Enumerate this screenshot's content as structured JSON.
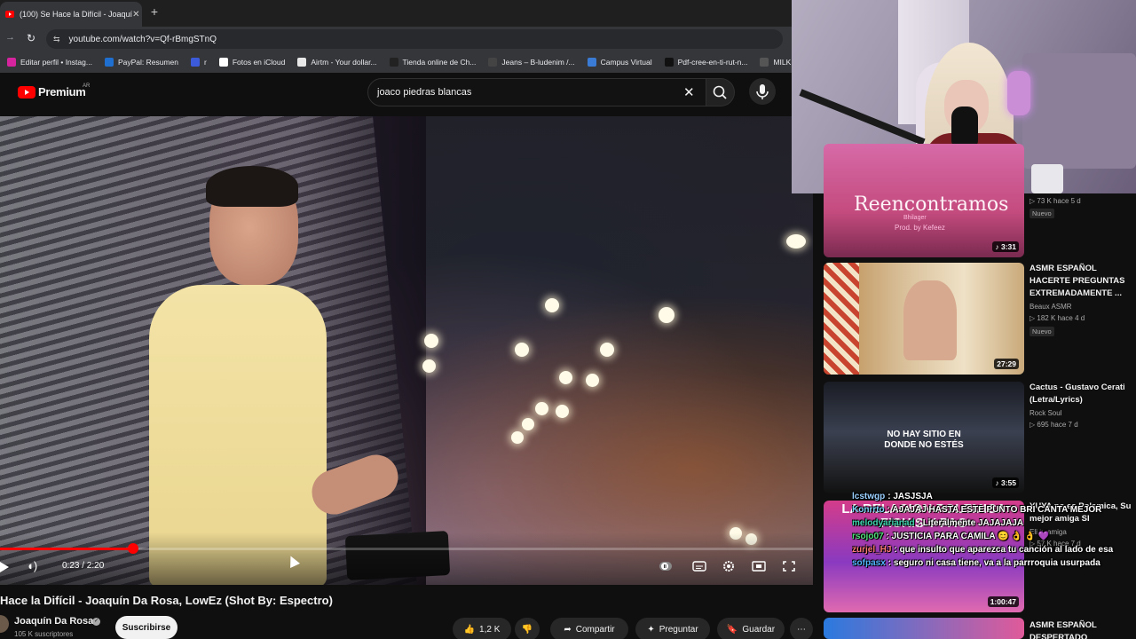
{
  "browser": {
    "tab_title": "(100) Se Hace la Difícil - Joaquí",
    "tab_close": "✕",
    "new_tab": "+",
    "back": "→",
    "reload": "↻",
    "site_info": "⇆",
    "url": "youtube.com/watch?v=Qf-rBmgSTnQ",
    "bookmarks": [
      {
        "label": "Editar perfil • Instag...",
        "color": "#d6249f"
      },
      {
        "label": "PayPal: Resumen",
        "color": "#1f6fd0"
      },
      {
        "label": "r",
        "color": "#3b5bdb"
      },
      {
        "label": "Fotos en iCloud",
        "color": "#ffffff"
      },
      {
        "label": "Airtm - Your dollar...",
        "color": "#e8e8e8"
      },
      {
        "label": "Tienda online de Ch...",
        "color": "#222222"
      },
      {
        "label": "Jeans – B-ludenim /...",
        "color": "#444444"
      },
      {
        "label": "Campus Virtual",
        "color": "#3a7bd5"
      },
      {
        "label": "Pdf-cree-en-ti-rut-n...",
        "color": "#111111"
      },
      {
        "label": "MILK | Sitio",
        "color": "#555555"
      }
    ]
  },
  "youtube": {
    "logo_text": "Premium",
    "logo_region": "AR",
    "search_query": "joaco piedras blancas",
    "search_clear": "✕",
    "video": {
      "progress_fraction": 0.164,
      "time": "0:23 / 2:20",
      "title": "Hace la Difícil - Joaquín Da Rosa, LowEz (Shot By: Espectro)",
      "channel": "Joaquín Da Rosa",
      "verified": "✓",
      "subscribers": "105 K suscriptores",
      "subscribe_label": "Suscribirse",
      "likes": "1,2 K",
      "share_label": "Compartir",
      "ask_label": "Preguntar",
      "save_label": "Guardar",
      "more": "⋯"
    },
    "sidebar": [
      {
        "title": "",
        "meta1": "▷ 73 K  hace 5 d",
        "badge": "Nuevo",
        "duration": "♪ 3:31",
        "thumb_text": "Reencontramos",
        "thumb_sub": "Prod. by Kefeez",
        "thumb_credit": "Bhilager"
      },
      {
        "title": "ASMR ESPAÑOL HACERTE PREGUNTAS EXTREMADAMENTE ...",
        "meta1": "Beaux ASMR",
        "meta2": "▷ 182 K  hace 4 d",
        "badge": "Nuevo",
        "duration": "27:29"
      },
      {
        "title": "Cactus - Gustavo Cerati (Letra/Lyrics)",
        "meta1": "Rock Soul",
        "meta2": "▷ 695  hace 7 d",
        "duration": "♪ 3:55",
        "thumb_text": "NO HAY SITIO EN DONDE NO ESTÉS"
      },
      {
        "title": "YUYA no es Polemica, Su mejor amiga SI",
        "meta1": "Eli tu amiga",
        "meta2": "▷ 57 K  hace 7 d",
        "duration": "1:00:47",
        "thumb_text": "LA RELACION POLEMICA FICHIS Y PAO"
      },
      {
        "title": "ASMR ESPAÑOL DESPERTADO HARDCORE en",
        "duration": ""
      }
    ]
  },
  "chat": [
    {
      "user": "lcstwgp",
      "color": "#9ad0ff",
      "text": ": JASJSJA"
    },
    {
      "user": "Konrrto",
      "color": "#7fd6ff",
      "text": ": AJAJAJ HASTA ESTE PUNTO BRI CANTA MEJOR"
    },
    {
      "user": "melodyarianad",
      "color": "#3fd6b0",
      "text": ": Literalmente JAJAJAJA"
    },
    {
      "user": "rsojo07",
      "color": "#4fe07a",
      "text": ": JUSTICIA PARA CAMILA 😊 👌 👌 💜"
    },
    {
      "user": "zurjel_HJ",
      "color": "#ff7a7a",
      "text": ": que insulto que aparezca tu canción al lado de esa"
    },
    {
      "user": "sofpasx",
      "color": "#4fb5ff",
      "text": ": seguro ni casa tiene, va a la parrroquia usurpada"
    }
  ]
}
